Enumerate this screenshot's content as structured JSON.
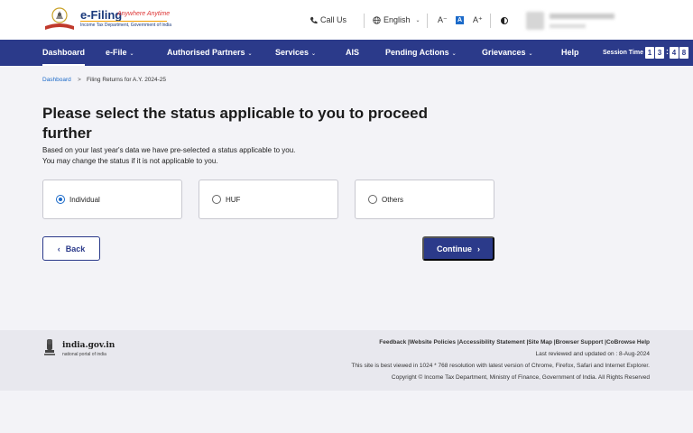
{
  "header": {
    "logo_title": "e-Filing",
    "logo_tagline": "Anywhere Anytime",
    "logo_subtitle": "Income Tax Department, Government of India",
    "call_us": "Call Us",
    "language": "English",
    "font_decrease": "A⁻",
    "font_normal": "A",
    "font_increase": "A⁺"
  },
  "nav": {
    "items": [
      {
        "label": "Dashboard",
        "dropdown": false
      },
      {
        "label": "e-File",
        "dropdown": true
      },
      {
        "label": "Authorised Partners",
        "dropdown": true
      },
      {
        "label": "Services",
        "dropdown": true
      },
      {
        "label": "AIS",
        "dropdown": false
      },
      {
        "label": "Pending Actions",
        "dropdown": true
      },
      {
        "label": "Grievances",
        "dropdown": true
      },
      {
        "label": "Help",
        "dropdown": false
      }
    ],
    "session_label": "Session Time",
    "session_digits": [
      "1",
      "3",
      "4",
      "8"
    ]
  },
  "breadcrumb": {
    "root": "Dashboard",
    "separator": ">",
    "current": "Filing Returns for A.Y. 2024-25"
  },
  "main": {
    "heading": "Please select the status applicable to you to proceed further",
    "desc_line1": "Based on your last year's data we have pre-selected a status applicable to you.",
    "desc_line2": "You may change the status if it is not applicable to you.",
    "options": [
      {
        "label": "Individual",
        "selected": true
      },
      {
        "label": "HUF",
        "selected": false
      },
      {
        "label": "Others",
        "selected": false
      }
    ],
    "back_label": "Back",
    "continue_label": "Continue"
  },
  "footer": {
    "brand": "india.gov.in",
    "brand_sub": "national portal of india",
    "links": "Feedback |Website Policies |Accessibility Statement |Site Map |Browser Support |CoBrowse Help",
    "reviewed": "Last reviewed and updated on : 8-Aug-2024",
    "best_viewed": "This site is best viewed in 1024 * 768 resolution with latest version of Chrome, Firefox, Safari and Internet Explorer.",
    "copyright": "Copyright © Income Tax Department, Ministry of Finance, Government of India. All Rights Reserved"
  },
  "colors": {
    "nav_bg": "#2b3a8a",
    "accent": "#1b6ac9",
    "page_bg": "#f3f3f7"
  }
}
